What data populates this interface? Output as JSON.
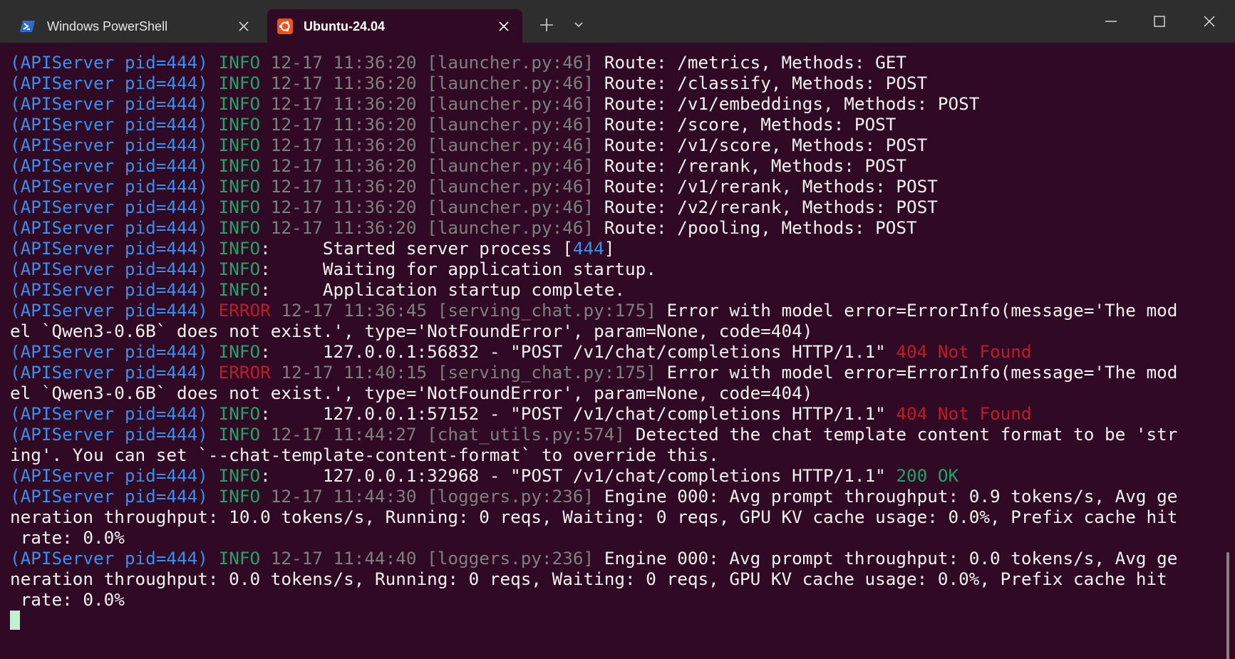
{
  "titlebar": {
    "tabs": [
      {
        "label": "Windows PowerShell",
        "icon": "powershell-icon",
        "active": false
      },
      {
        "label": "Ubuntu-24.04",
        "icon": "ubuntu-icon",
        "active": true
      }
    ],
    "new_tab_icon": "plus-icon",
    "dropdown_icon": "chevron-down-icon",
    "window_controls": [
      "minimize-icon",
      "maximize-icon",
      "close-icon"
    ]
  },
  "colors": {
    "terminal_bg": "#300a24",
    "titlebar_bg": "#2e2e2e",
    "source": "#3b8eea",
    "info": "#26a269",
    "error": "#c01c28",
    "dim": "#7f7f7f",
    "text": "#f2f2f2",
    "cursor": "#c0f0d0"
  },
  "terminal": {
    "lines": [
      [
        [
          "c-blue",
          "(APIServer pid=444) "
        ],
        [
          "c-green",
          "INFO "
        ],
        [
          "c-gray",
          "12-17 11:36:20 [launcher.py:46] "
        ],
        [
          "c-white",
          "Route: /metrics, Methods: GET"
        ]
      ],
      [
        [
          "c-blue",
          "(APIServer pid=444) "
        ],
        [
          "c-green",
          "INFO "
        ],
        [
          "c-gray",
          "12-17 11:36:20 [launcher.py:46] "
        ],
        [
          "c-white",
          "Route: /classify, Methods: POST"
        ]
      ],
      [
        [
          "c-blue",
          "(APIServer pid=444) "
        ],
        [
          "c-green",
          "INFO "
        ],
        [
          "c-gray",
          "12-17 11:36:20 [launcher.py:46] "
        ],
        [
          "c-white",
          "Route: /v1/embeddings, Methods: POST"
        ]
      ],
      [
        [
          "c-blue",
          "(APIServer pid=444) "
        ],
        [
          "c-green",
          "INFO "
        ],
        [
          "c-gray",
          "12-17 11:36:20 [launcher.py:46] "
        ],
        [
          "c-white",
          "Route: /score, Methods: POST"
        ]
      ],
      [
        [
          "c-blue",
          "(APIServer pid=444) "
        ],
        [
          "c-green",
          "INFO "
        ],
        [
          "c-gray",
          "12-17 11:36:20 [launcher.py:46] "
        ],
        [
          "c-white",
          "Route: /v1/score, Methods: POST"
        ]
      ],
      [
        [
          "c-blue",
          "(APIServer pid=444) "
        ],
        [
          "c-green",
          "INFO "
        ],
        [
          "c-gray",
          "12-17 11:36:20 [launcher.py:46] "
        ],
        [
          "c-white",
          "Route: /rerank, Methods: POST"
        ]
      ],
      [
        [
          "c-blue",
          "(APIServer pid=444) "
        ],
        [
          "c-green",
          "INFO "
        ],
        [
          "c-gray",
          "12-17 11:36:20 [launcher.py:46] "
        ],
        [
          "c-white",
          "Route: /v1/rerank, Methods: POST"
        ]
      ],
      [
        [
          "c-blue",
          "(APIServer pid=444) "
        ],
        [
          "c-green",
          "INFO "
        ],
        [
          "c-gray",
          "12-17 11:36:20 [launcher.py:46] "
        ],
        [
          "c-white",
          "Route: /v2/rerank, Methods: POST"
        ]
      ],
      [
        [
          "c-blue",
          "(APIServer pid=444) "
        ],
        [
          "c-green",
          "INFO "
        ],
        [
          "c-gray",
          "12-17 11:36:20 [launcher.py:46] "
        ],
        [
          "c-white",
          "Route: /pooling, Methods: POST"
        ]
      ],
      [
        [
          "c-blue",
          "(APIServer pid=444) "
        ],
        [
          "c-green",
          "INFO"
        ],
        [
          "c-white",
          ":     Started server process ["
        ],
        [
          "c-blue",
          "444"
        ],
        [
          "c-white",
          "]"
        ]
      ],
      [
        [
          "c-blue",
          "(APIServer pid=444) "
        ],
        [
          "c-green",
          "INFO"
        ],
        [
          "c-white",
          ":     Waiting for application startup."
        ]
      ],
      [
        [
          "c-blue",
          "(APIServer pid=444) "
        ],
        [
          "c-green",
          "INFO"
        ],
        [
          "c-white",
          ":     Application startup complete."
        ]
      ],
      [
        [
          "c-blue",
          "(APIServer pid=444) "
        ],
        [
          "c-red",
          "ERROR "
        ],
        [
          "c-gray",
          "12-17 11:36:45 [serving_chat.py:175] "
        ],
        [
          "c-white",
          "Error with model error=ErrorInfo(message='The mod"
        ]
      ],
      [
        [
          "c-white",
          "el `Qwen3-0.6B` does not exist.', type='NotFoundError', param=None, code=404)"
        ]
      ],
      [
        [
          "c-blue",
          "(APIServer pid=444) "
        ],
        [
          "c-green",
          "INFO"
        ],
        [
          "c-white",
          ":     127.0.0.1:56832 - \"POST /v1/chat/completions HTTP/1.1\" "
        ],
        [
          "c-red",
          "404 Not Found"
        ]
      ],
      [
        [
          "c-blue",
          "(APIServer pid=444) "
        ],
        [
          "c-red",
          "ERROR "
        ],
        [
          "c-gray",
          "12-17 11:40:15 [serving_chat.py:175] "
        ],
        [
          "c-white",
          "Error with model error=ErrorInfo(message='The mod"
        ]
      ],
      [
        [
          "c-white",
          "el `Qwen3-0.6B` does not exist.', type='NotFoundError', param=None, code=404)"
        ]
      ],
      [
        [
          "c-blue",
          "(APIServer pid=444) "
        ],
        [
          "c-green",
          "INFO"
        ],
        [
          "c-white",
          ":     127.0.0.1:57152 - \"POST /v1/chat/completions HTTP/1.1\" "
        ],
        [
          "c-red",
          "404 Not Found"
        ]
      ],
      [
        [
          "c-blue",
          "(APIServer pid=444) "
        ],
        [
          "c-green",
          "INFO "
        ],
        [
          "c-gray",
          "12-17 11:44:27 [chat_utils.py:574] "
        ],
        [
          "c-white",
          "Detected the chat template content format to be 'str"
        ]
      ],
      [
        [
          "c-white",
          "ing'. You can set `--chat-template-content-format` to override this."
        ]
      ],
      [
        [
          "c-blue",
          "(APIServer pid=444) "
        ],
        [
          "c-green",
          "INFO"
        ],
        [
          "c-white",
          ":     127.0.0.1:32968 - \"POST /v1/chat/completions HTTP/1.1\" "
        ],
        [
          "c-green",
          "200 OK"
        ]
      ],
      [
        [
          "c-blue",
          "(APIServer pid=444) "
        ],
        [
          "c-green",
          "INFO "
        ],
        [
          "c-gray",
          "12-17 11:44:30 [loggers.py:236] "
        ],
        [
          "c-white",
          "Engine 000: Avg prompt throughput: 0.9 tokens/s, Avg ge"
        ]
      ],
      [
        [
          "c-white",
          "neration throughput: 10.0 tokens/s, Running: 0 reqs, Waiting: 0 reqs, GPU KV cache usage: 0.0%, Prefix cache hit"
        ]
      ],
      [
        [
          "c-white",
          " rate: 0.0%"
        ]
      ],
      [
        [
          "c-blue",
          "(APIServer pid=444) "
        ],
        [
          "c-green",
          "INFO "
        ],
        [
          "c-gray",
          "12-17 11:44:40 [loggers.py:236] "
        ],
        [
          "c-white",
          "Engine 000: Avg prompt throughput: 0.0 tokens/s, Avg ge"
        ]
      ],
      [
        [
          "c-white",
          "neration throughput: 0.0 tokens/s, Running: 0 reqs, Waiting: 0 reqs, GPU KV cache usage: 0.0%, Prefix cache hit"
        ]
      ],
      [
        [
          "c-white",
          " rate: 0.0%"
        ]
      ]
    ]
  }
}
